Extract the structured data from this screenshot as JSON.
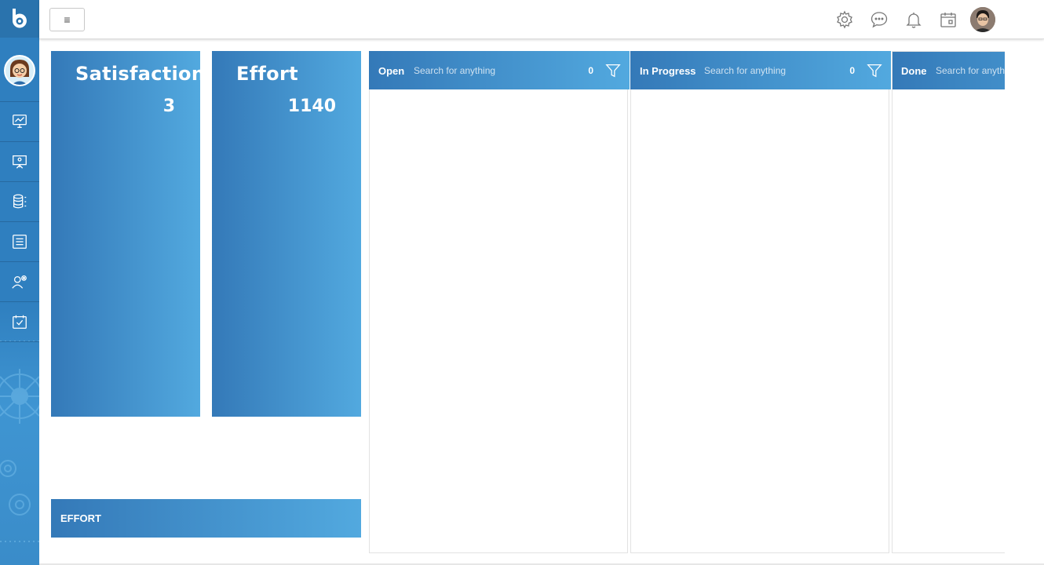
{
  "topbar": {
    "menu_glyph": "≡",
    "icons": [
      "settings-icon",
      "chat-icon",
      "bell-icon",
      "calendar-icon"
    ]
  },
  "sidebar": {
    "items": [
      {
        "icon": "analytics-monitor-icon"
      },
      {
        "icon": "presentation-board-icon"
      },
      {
        "icon": "database-icon"
      },
      {
        "icon": "checklist-icon"
      },
      {
        "icon": "user-settings-icon"
      },
      {
        "icon": "calendar-check-icon"
      }
    ]
  },
  "cards": {
    "satisfaction": {
      "title": "Satisfaction",
      "value": "3"
    },
    "effort": {
      "title": "Effort",
      "value": "1140"
    }
  },
  "effort_bar": {
    "label": "EFFORT"
  },
  "columns": [
    {
      "name": "Open",
      "placeholder": "Search for anything",
      "count": "0"
    },
    {
      "name": "In Progress",
      "placeholder": "Search for anything",
      "count": "0"
    },
    {
      "name": "Done",
      "placeholder": "Search for anything"
    }
  ],
  "colors": {
    "sidebar": "#2f7fbf",
    "gradient_start": "#3479b8",
    "gradient_end": "#52a9df"
  }
}
